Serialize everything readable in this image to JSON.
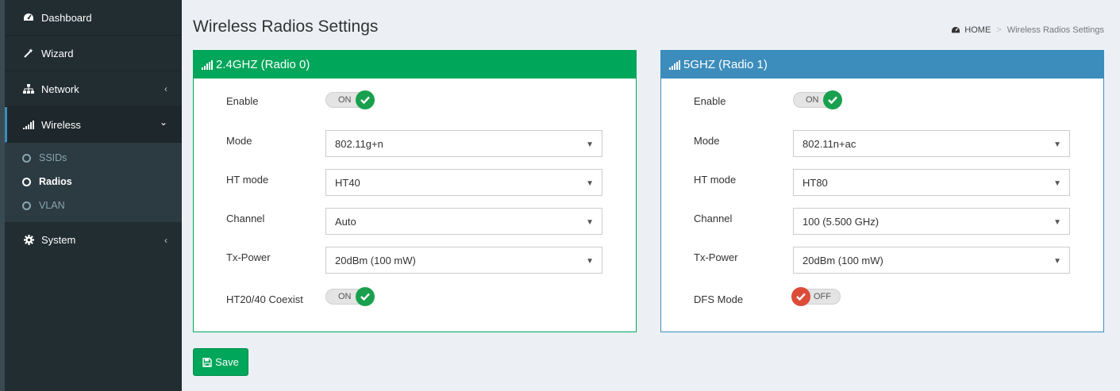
{
  "sidebar": {
    "items": [
      {
        "label": "Dashboard",
        "icon": "dashboard-icon"
      },
      {
        "label": "Wizard",
        "icon": "magic-wand-icon"
      },
      {
        "label": "Network",
        "icon": "sitemap-icon",
        "chevron": "‹"
      },
      {
        "label": "Wireless",
        "icon": "signal-icon",
        "chevron": "⌄"
      },
      {
        "label": "System",
        "icon": "gear-icon",
        "chevron": "‹"
      }
    ],
    "submenu": [
      {
        "label": "SSIDs"
      },
      {
        "label": "Radios"
      },
      {
        "label": "VLAN"
      }
    ]
  },
  "header": {
    "title": "Wireless Radios Settings",
    "breadcrumb_home": "HOME",
    "breadcrumb_sep": ">",
    "breadcrumb_current": "Wireless Radios Settings"
  },
  "radio0": {
    "title": "2.4GHZ (Radio 0)",
    "enable_label": "Enable",
    "enable_state": "ON",
    "mode_label": "Mode",
    "mode_value": "802.11g+n",
    "htmode_label": "HT mode",
    "htmode_value": "HT40",
    "channel_label": "Channel",
    "channel_value": "Auto",
    "txpower_label": "Tx-Power",
    "txpower_value": "20dBm (100 mW)",
    "coexist_label": "HT20/40 Coexist",
    "coexist_state": "ON"
  },
  "radio1": {
    "title": "5GHZ (Radio 1)",
    "enable_label": "Enable",
    "enable_state": "ON",
    "mode_label": "Mode",
    "mode_value": "802.11n+ac",
    "htmode_label": "HT mode",
    "htmode_value": "HT80",
    "channel_label": "Channel",
    "channel_value": "100 (5.500 GHz)",
    "txpower_label": "Tx-Power",
    "txpower_value": "20dBm (100 mW)",
    "dfs_label": "DFS Mode",
    "dfs_state": "OFF"
  },
  "footer": {
    "save_label": "Save"
  },
  "colors": {
    "green": "#00a65a",
    "blue": "#3c8dbc",
    "red": "#dd4b39",
    "sidebar": "#222d32"
  }
}
